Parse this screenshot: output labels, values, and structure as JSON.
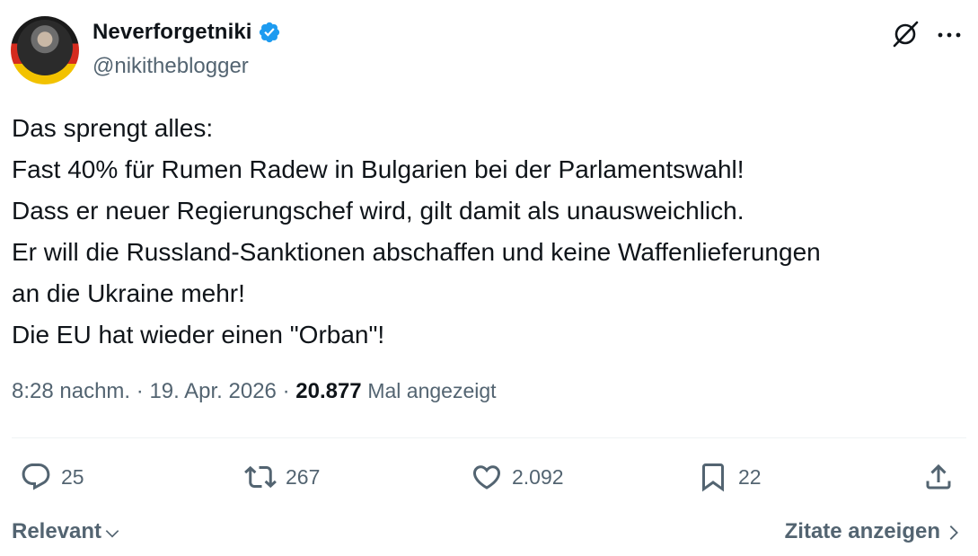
{
  "author": {
    "display_name": "Neverforgetniki",
    "handle": "@nikitheblogger",
    "verified": true
  },
  "tweet": {
    "lines": [
      "Das sprengt alles:",
      "Fast 40% für Rumen Radew in Bulgarien bei der Parlamentswahl!",
      "Dass er neuer Regierungschef wird, gilt damit als unausweichlich.",
      "Er will die Russland-Sanktionen abschaffen und keine Waffenlieferungen",
      "an die Ukraine mehr!",
      "Die EU hat wieder einen \"Orban\"!"
    ]
  },
  "meta": {
    "time": "8:28 nachm.",
    "separator": "·",
    "date": "19. Apr. 2026",
    "views_count": "20.877",
    "views_label": "Mal angezeigt"
  },
  "actions": {
    "replies": "25",
    "retweets": "267",
    "likes": "2.092",
    "bookmarks": "22"
  },
  "footer": {
    "sort_label": "Relevant",
    "quotes_label": "Zitate anzeigen"
  },
  "colors": {
    "text": "#0f1419",
    "secondary": "#536471",
    "verified": "#1d9bf0",
    "divider": "#eff3f4"
  },
  "icons": {
    "verified": "verified-badge-icon",
    "grok": "grok-icon",
    "more": "more-icon",
    "reply": "reply-icon",
    "retweet": "retweet-icon",
    "like": "heart-icon",
    "bookmark": "bookmark-icon",
    "share": "share-icon"
  }
}
